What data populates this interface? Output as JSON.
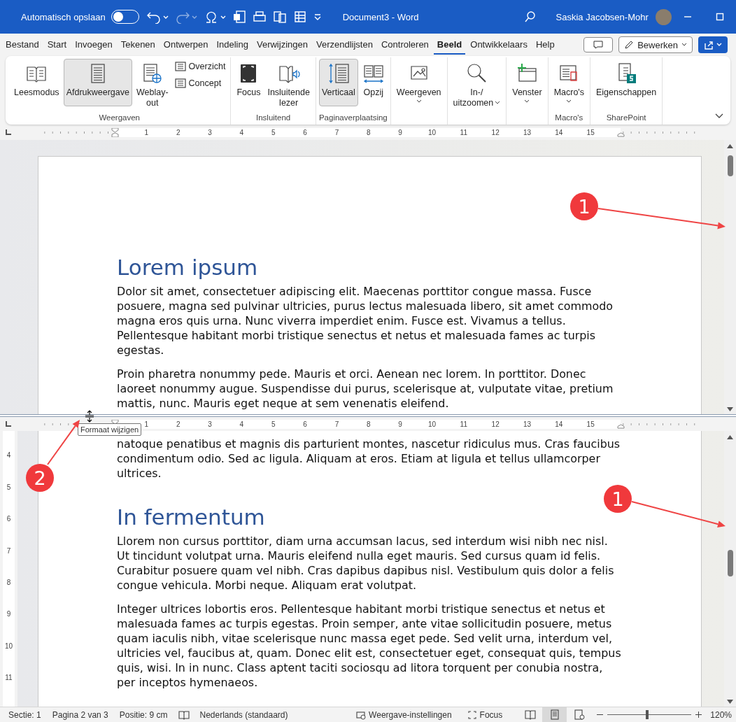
{
  "title_bar": {
    "autosave_label": "Automatisch opslaan",
    "autosave_on": false,
    "document_title": "Document3  -  Word",
    "user_name": "Saskia Jacobsen-Mohr"
  },
  "menu_tabs": [
    {
      "label": "Bestand",
      "selected": false
    },
    {
      "label": "Start",
      "selected": false
    },
    {
      "label": "Invoegen",
      "selected": false
    },
    {
      "label": "Tekenen",
      "selected": false
    },
    {
      "label": "Ontwerpen",
      "selected": false
    },
    {
      "label": "Indeling",
      "selected": false
    },
    {
      "label": "Verwijzingen",
      "selected": false
    },
    {
      "label": "Verzendlijsten",
      "selected": false
    },
    {
      "label": "Controleren",
      "selected": false
    },
    {
      "label": "Beeld",
      "selected": true
    },
    {
      "label": "Ontwikkelaars",
      "selected": false
    },
    {
      "label": "Help",
      "selected": false
    }
  ],
  "edit_button": {
    "label": "Bewerken"
  },
  "ribbon_groups": [
    {
      "label": "Weergaven",
      "buttons": [
        {
          "label": "Leesmodus",
          "kind": "large",
          "selected": false,
          "dropdown": false
        },
        {
          "label": "Afdrukweergave",
          "kind": "large",
          "selected": true,
          "dropdown": false
        },
        {
          "label": "Weblay-\nout",
          "kind": "large",
          "selected": false,
          "dropdown": false
        },
        {
          "label": "Overzicht",
          "kind": "small",
          "selected": false,
          "dropdown": false
        },
        {
          "label": "Concept",
          "kind": "small",
          "selected": false,
          "dropdown": false
        }
      ]
    },
    {
      "label": "Insluitend",
      "buttons": [
        {
          "label": "Focus",
          "kind": "large",
          "selected": false,
          "dropdown": false
        },
        {
          "label": "Insluitende\nlezer",
          "kind": "large",
          "selected": false,
          "dropdown": false
        }
      ]
    },
    {
      "label": "Paginaverplaatsing",
      "buttons": [
        {
          "label": "Verticaal",
          "kind": "large",
          "selected": true,
          "dropdown": false
        },
        {
          "label": "Opzij",
          "kind": "large",
          "selected": false,
          "dropdown": false
        }
      ]
    },
    {
      "buttons": [
        {
          "label": "Weergeven",
          "kind": "large",
          "selected": false,
          "dropdown": true
        }
      ]
    },
    {
      "buttons": [
        {
          "label": "In-/\nuitzoomen",
          "kind": "large",
          "selected": false,
          "dropdown": true
        }
      ]
    },
    {
      "buttons": [
        {
          "label": "Venster",
          "kind": "large",
          "selected": false,
          "dropdown": true
        }
      ]
    },
    {
      "label": "Macro's",
      "buttons": [
        {
          "label": "Macro's",
          "kind": "large",
          "selected": false,
          "dropdown": true
        }
      ]
    },
    {
      "label": "SharePoint",
      "buttons": [
        {
          "label": "Eigenschappen",
          "kind": "large",
          "selected": false,
          "dropdown": false
        }
      ]
    }
  ],
  "top_ruler": [
    "1",
    "2",
    "3",
    "4",
    "5",
    "6",
    "7",
    "8",
    "9",
    "10",
    "11",
    "12",
    "13",
    "14",
    "15"
  ],
  "top_pane": {
    "blocks": [
      {
        "kind": "heading",
        "text": "Lorem ipsum"
      },
      {
        "kind": "paragraph",
        "text": "Dolor sit amet, consectetuer adipiscing elit. Maecenas porttitor congue massa. Fusce posuere, magna sed pulvinar ultricies, purus lectus malesuada libero, sit amet commodo magna eros quis urna. Nunc viverra imperdiet enim. Fusce est. Vivamus a tellus. Pellentesque habitant morbi tristique senectus et netus et malesuada fames ac turpis egestas."
      },
      {
        "kind": "paragraph",
        "text": "Proin pharetra nonummy pede. Mauris et orci. Aenean nec lorem. In porttitor. Donec laoreet nonummy augue. Suspendisse dui purus, scelerisque at, vulputate vitae, pretium mattis, nunc. Mauris eget neque at sem venenatis eleifend."
      }
    ]
  },
  "bottom_ruler": [
    "1",
    "2",
    "3",
    "4",
    "5",
    "6",
    "7",
    "8",
    "9",
    "10",
    "11",
    "12",
    "13",
    "14",
    "15"
  ],
  "side_ruler": [
    "4",
    "5",
    "6",
    "7",
    "8",
    "9",
    "10",
    "11"
  ],
  "bottom_pane": {
    "blocks": [
      {
        "kind": "paragraph",
        "text": "natoque penatibus et magnis dis parturient montes, nascetur ridiculus mus. Cras faucibus condimentum odio. Sed ac ligula. Aliquam at eros. Etiam at ligula et tellus ullamcorper ultrices."
      },
      {
        "kind": "heading",
        "text": "In fermentum"
      },
      {
        "kind": "paragraph",
        "text": "Llorem non cursus porttitor, diam urna accumsan lacus, sed interdum wisi nibh nec nisl. Ut tincidunt volutpat urna. Mauris eleifend nulla eget mauris. Sed cursus quam id felis. Curabitur posuere quam vel nibh. Cras dapibus dapibus nisl. Vestibulum quis dolor a felis congue vehicula. Morbi neque. Aliquam erat volutpat."
      },
      {
        "kind": "paragraph",
        "text": "Integer ultrices lobortis eros. Pellentesque habitant morbi tristique senectus et netus et malesuada fames ac turpis egestas. Proin semper, ante vitae sollicitudin posuere, metus quam iaculis nibh, vitae scelerisque nunc massa eget pede. Sed velit urna, interdum vel, ultricies vel, faucibus at, quam. Donec elit est, consectetuer eget, consequat quis, tempus quis, wisi. In in nunc. Class aptent taciti sociosqu ad litora torquent per conubia nostra, per inceptos hymenaeos."
      }
    ]
  },
  "tooltip": "Formaat wijzigen",
  "callouts": [
    {
      "number": "1"
    },
    {
      "number": "1"
    },
    {
      "number": "2"
    }
  ],
  "status_bar": {
    "items": [
      "Sectie: 1",
      "Pagina 2 van 3",
      "Positie: 9 cm"
    ],
    "language": "Nederlands (standaard)",
    "display_settings": "Weergave-instellingen",
    "focus": "Focus",
    "views": [
      {
        "selected": false
      },
      {
        "selected": true
      },
      {
        "selected": false
      }
    ],
    "zoom": {
      "level": 0.47,
      "percent": "120%"
    }
  }
}
